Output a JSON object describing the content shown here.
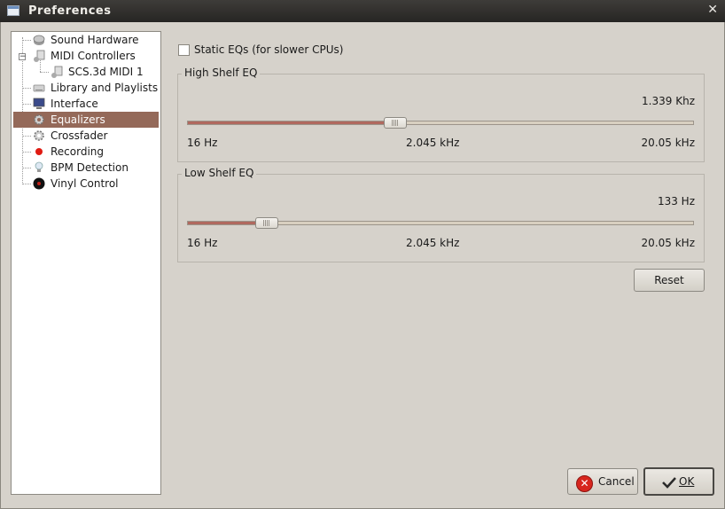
{
  "window": {
    "title": "Preferences",
    "close_glyph": "✕"
  },
  "tree": {
    "items": [
      {
        "label": "Sound Hardware",
        "icon": "speaker-icon"
      },
      {
        "label": "MIDI Controllers",
        "icon": "midi-controllers-icon",
        "expander": "−"
      },
      {
        "label": "SCS.3d MIDI 1",
        "icon": "midi-device-icon"
      },
      {
        "label": "Library and Playlists",
        "icon": "drive-icon"
      },
      {
        "label": "Interface",
        "icon": "monitor-icon"
      },
      {
        "label": "Equalizers",
        "icon": "gear-icon",
        "selected": true
      },
      {
        "label": "Crossfader",
        "icon": "gear-icon"
      },
      {
        "label": "Recording",
        "icon": "record-icon"
      },
      {
        "label": "BPM Detection",
        "icon": "lightbulb-icon"
      },
      {
        "label": "Vinyl Control",
        "icon": "vinyl-icon"
      }
    ]
  },
  "static_eq": {
    "label": "Static EQs (for slower CPUs)",
    "checked": false
  },
  "high_shelf": {
    "title": "High Shelf EQ",
    "value": "1.339 Khz",
    "position_fraction": 0.41,
    "tick_min": "16 Hz",
    "tick_mid": "2.045 kHz",
    "tick_max": "20.05 kHz"
  },
  "low_shelf": {
    "title": "Low Shelf EQ",
    "value": "133 Hz",
    "position_fraction": 0.157,
    "tick_min": "16 Hz",
    "tick_mid": "2.045 kHz",
    "tick_max": "20.05 kHz"
  },
  "buttons": {
    "reset": "Reset",
    "cancel": "Cancel",
    "ok": "OK"
  },
  "colors": {
    "selection": "#946959",
    "slider_fill": "#b0695f"
  }
}
